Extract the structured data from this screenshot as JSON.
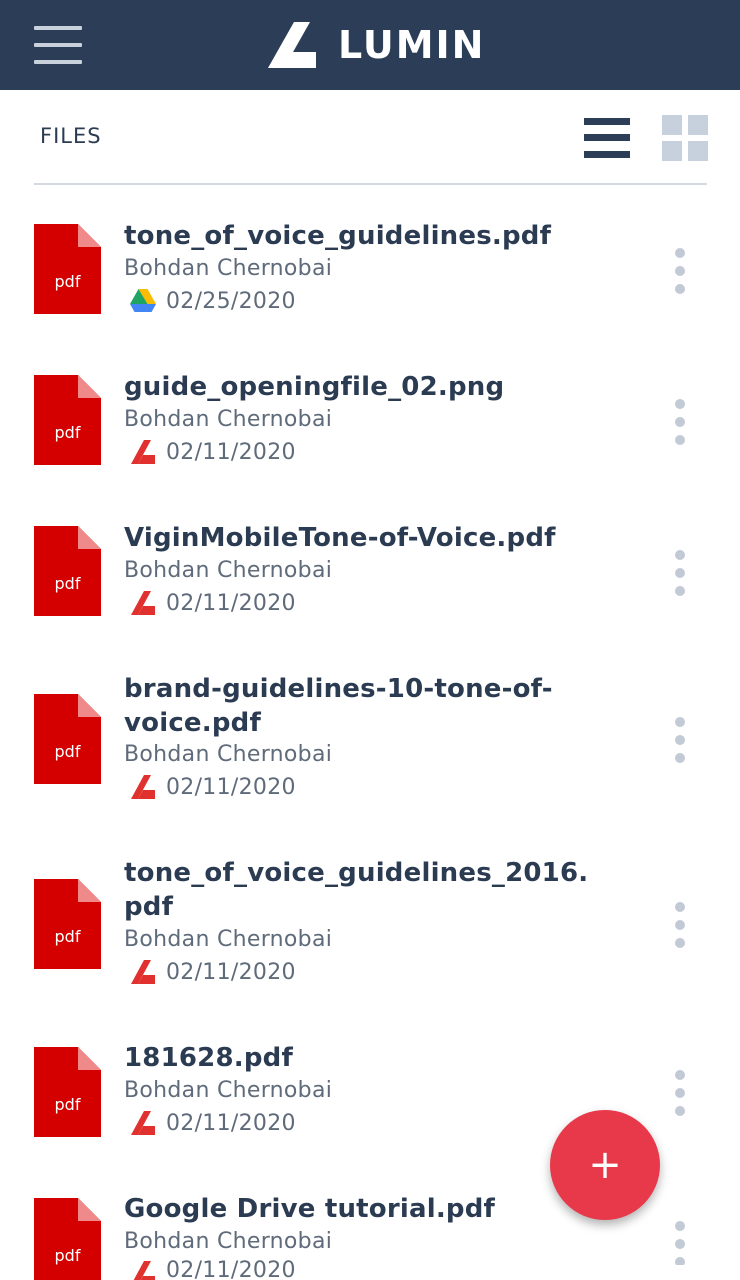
{
  "header": {
    "brand_name": "LUMIN"
  },
  "toolbar": {
    "section_label": "FILES"
  },
  "fab": {
    "label": "+"
  },
  "colors": {
    "header_bg": "#2c3e57",
    "pdf_red": "#d40000",
    "accent_red": "#e8394a",
    "text_dark": "#2b3b52",
    "text_muted": "#5f6b7a"
  },
  "files": [
    {
      "name": "tone_of_voice_guidelines.pdf",
      "owner": "Bohdan Chernobai",
      "date": "02/25/2020",
      "source": "google-drive-icon",
      "type_label": "pdf"
    },
    {
      "name": "guide_openingfile_02.png",
      "owner": "Bohdan Chernobai",
      "date": "02/11/2020",
      "source": "lumin-icon",
      "type_label": "pdf"
    },
    {
      "name": "ViginMobileTone-of-Voice.pdf",
      "owner": "Bohdan Chernobai",
      "date": "02/11/2020",
      "source": "lumin-icon",
      "type_label": "pdf"
    },
    {
      "name": "brand-guidelines-10-tone-of-\nvoice.pdf",
      "owner": "Bohdan Chernobai",
      "date": "02/11/2020",
      "source": "lumin-icon",
      "type_label": "pdf"
    },
    {
      "name": "tone_of_voice_guidelines_2016.\npdf",
      "owner": "Bohdan Chernobai",
      "date": "02/11/2020",
      "source": "lumin-icon",
      "type_label": "pdf"
    },
    {
      "name": "181628.pdf",
      "owner": "Bohdan Chernobai",
      "date": "02/11/2020",
      "source": "lumin-icon",
      "type_label": "pdf"
    },
    {
      "name": "Google Drive tutorial.pdf",
      "owner": "Bohdan Chernobai",
      "date": "02/11/2020",
      "source": "lumin-icon",
      "type_label": "pdf"
    }
  ]
}
